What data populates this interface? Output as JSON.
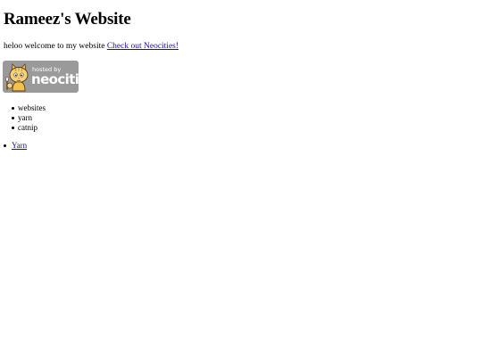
{
  "page": {
    "title": "Rameez's Website",
    "intro_text": "heloo welcome to my website ",
    "intro_link": "Check out Neocities!"
  },
  "badge": {
    "small_text": "hosted by",
    "big_text": "neocities",
    "icon": "neocities-cat-icon",
    "background_color": "#9a9a9a"
  },
  "tags": [
    {
      "label": "websites"
    },
    {
      "label": "yarn"
    },
    {
      "label": "catnip"
    }
  ],
  "nav": [
    {
      "label": "Yarn"
    }
  ],
  "colors": {
    "link": "#1a0dab",
    "text": "#000000",
    "background": "#ffffff"
  }
}
